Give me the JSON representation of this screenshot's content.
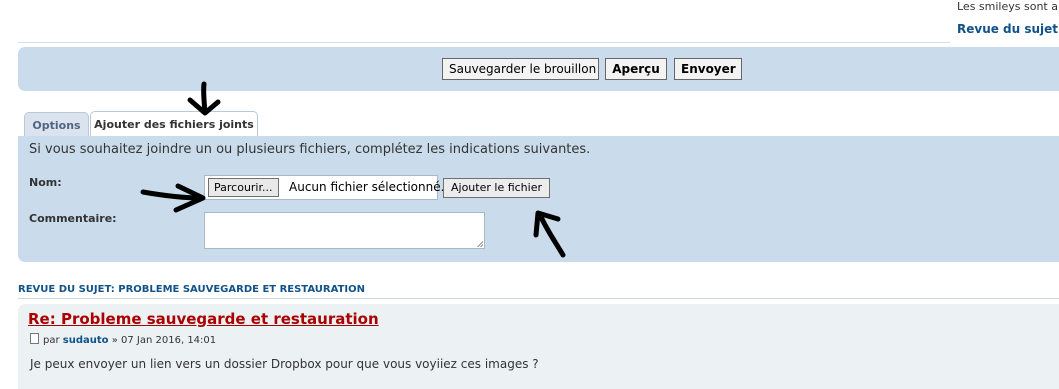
{
  "top_right": {
    "smileys_text": "Les smileys sont a",
    "review_link": "Revue du sujet"
  },
  "submit_buttons": {
    "save_draft": "Sauvegarder le brouillon",
    "preview": "Aperçu",
    "send": "Envoyer"
  },
  "tabs": [
    {
      "label": "Options",
      "active": false
    },
    {
      "label": "Ajouter des fichiers joints",
      "active": true
    }
  ],
  "attach": {
    "intro": "Si vous souhaitez joindre un ou plusieurs fichiers, complétez les indications suivantes.",
    "name_label": "Nom:",
    "browse_button": "Parcourir...",
    "no_file_text": "Aucun fichier sélectionné.",
    "add_file_button": "Ajouter le fichier",
    "comment_label": "Commentaire:",
    "comment_value": ""
  },
  "review": {
    "heading": "REVUE DU SUJET: PROBLEME SAUVEGARDE ET RESTAURATION",
    "post": {
      "title": "Re: Probleme sauvegarde et restauration",
      "by": "par",
      "author": "sudauto",
      "date": "» 07 Jan 2016, 14:01",
      "body": "Je peux envoyer un lien vers un dossier Dropbox pour que vous voyiiez ces images ?"
    }
  },
  "colors": {
    "panel_bg": "#cadceb",
    "post_bg": "#ecf1f3",
    "link_blue": "#105289",
    "title_red": "#aa0000"
  },
  "icons": [
    "post-icon",
    "annotation-arrow"
  ]
}
